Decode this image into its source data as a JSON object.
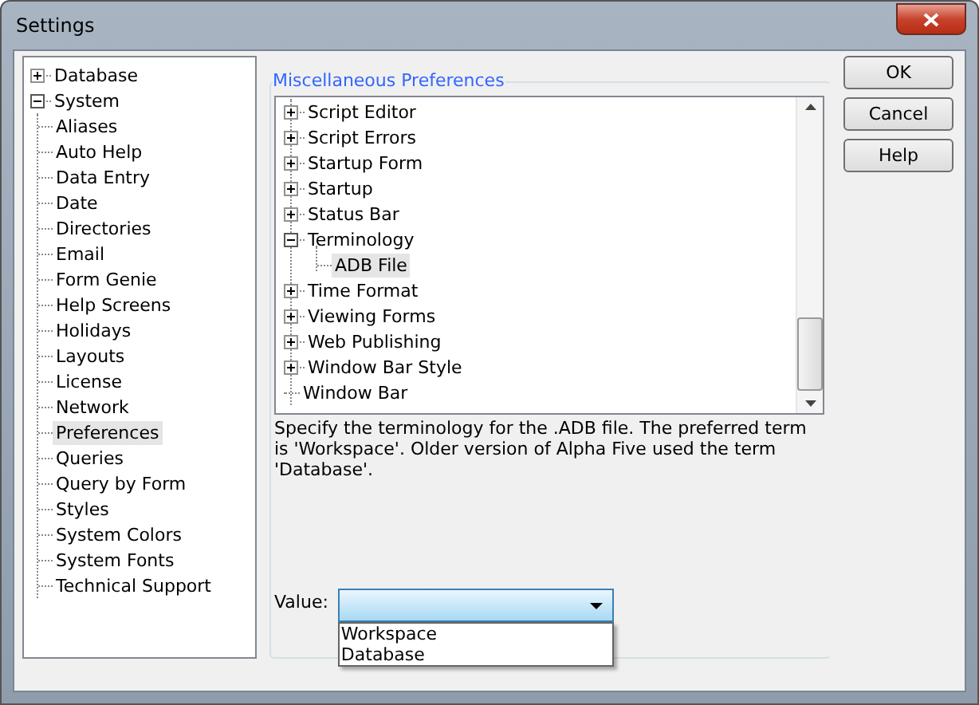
{
  "window": {
    "title": "Settings"
  },
  "sidebar": {
    "items": [
      {
        "label": "Database",
        "expanded": false,
        "selected": false
      },
      {
        "label": "System",
        "expanded": true,
        "selected": false,
        "children": [
          {
            "label": "Aliases",
            "selected": false
          },
          {
            "label": "Auto Help",
            "selected": false
          },
          {
            "label": "Data Entry",
            "selected": false
          },
          {
            "label": "Date",
            "selected": false
          },
          {
            "label": "Directories",
            "selected": false
          },
          {
            "label": "Email",
            "selected": false
          },
          {
            "label": "Form Genie",
            "selected": false
          },
          {
            "label": "Help Screens",
            "selected": false
          },
          {
            "label": "Holidays",
            "selected": false
          },
          {
            "label": "Layouts",
            "selected": false
          },
          {
            "label": "License",
            "selected": false
          },
          {
            "label": "Network",
            "selected": false
          },
          {
            "label": "Preferences",
            "selected": true
          },
          {
            "label": "Queries",
            "selected": false
          },
          {
            "label": "Query by Form",
            "selected": false
          },
          {
            "label": "Styles",
            "selected": false
          },
          {
            "label": "System Colors",
            "selected": false
          },
          {
            "label": "System Fonts",
            "selected": false
          },
          {
            "label": "Technical Support",
            "selected": false
          }
        ]
      }
    ]
  },
  "group": {
    "title": "Miscellaneous Preferences",
    "tree": [
      {
        "label": "Script Editor",
        "kind": "folder",
        "expanded": false
      },
      {
        "label": "Script Errors",
        "kind": "folder",
        "expanded": false
      },
      {
        "label": "Startup Form",
        "kind": "folder",
        "expanded": false
      },
      {
        "label": "Startup",
        "kind": "folder",
        "expanded": false
      },
      {
        "label": "Status Bar",
        "kind": "folder",
        "expanded": false
      },
      {
        "label": "Terminology",
        "kind": "folder",
        "expanded": true,
        "children": [
          {
            "label": "ADB File",
            "selected": true
          }
        ]
      },
      {
        "label": "Time Format",
        "kind": "folder",
        "expanded": false
      },
      {
        "label": "Viewing Forms",
        "kind": "folder",
        "expanded": false
      },
      {
        "label": "Web Publishing",
        "kind": "folder",
        "expanded": false
      },
      {
        "label": "Window Bar Style",
        "kind": "folder",
        "expanded": false
      },
      {
        "label": "Window Bar",
        "kind": "leaf"
      }
    ],
    "description": "Specify the terminology for the .ADB file. The preferred term is 'Workspace'. Older version of Alpha Five used the term 'Database'.",
    "value_label": "Value:",
    "value": {
      "expanded": true,
      "options": [
        "Workspace",
        "Database"
      ]
    }
  },
  "buttons": [
    "OK",
    "Cancel",
    "Help"
  ]
}
